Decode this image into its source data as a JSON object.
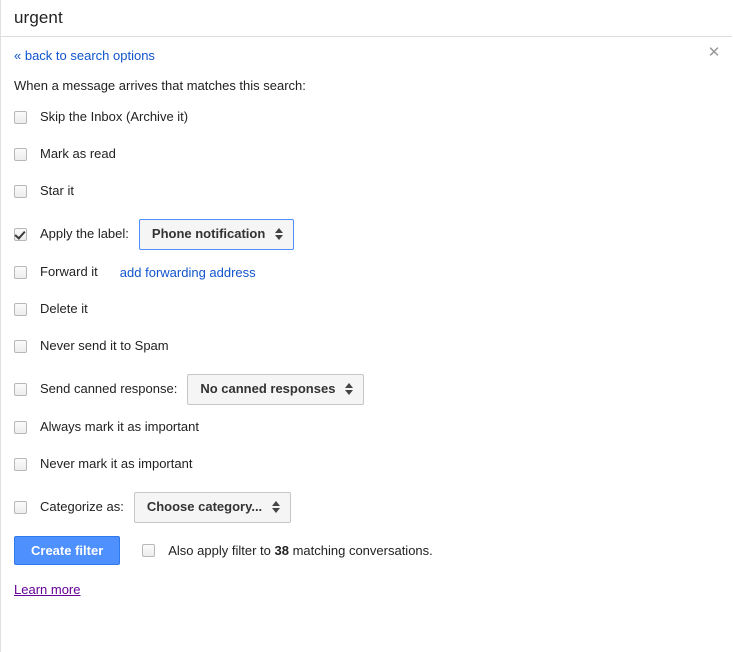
{
  "search": {
    "query": "urgent"
  },
  "panel": {
    "close_icon": "close-icon",
    "back_link": "« back to search options",
    "intro": "When a message arrives that matches this search:"
  },
  "options": [
    {
      "label": "Skip the Inbox (Archive it)",
      "checked": false,
      "name": "skip-inbox"
    },
    {
      "label": "Mark as read",
      "checked": false,
      "name": "mark-as-read"
    },
    {
      "label": "Star it",
      "checked": false,
      "name": "star-it"
    },
    {
      "label": "Apply the label:",
      "checked": true,
      "name": "apply-label"
    },
    {
      "label": "Forward it",
      "checked": false,
      "name": "forward-it"
    },
    {
      "label": "Delete it",
      "checked": false,
      "name": "delete-it"
    },
    {
      "label": "Never send it to Spam",
      "checked": false,
      "name": "never-spam"
    },
    {
      "label": "Send canned response:",
      "checked": false,
      "name": "send-canned-response"
    },
    {
      "label": "Always mark it as important",
      "checked": false,
      "name": "always-important"
    },
    {
      "label": "Never mark it as important",
      "checked": false,
      "name": "never-important"
    },
    {
      "label": "Categorize as:",
      "checked": false,
      "name": "categorize-as"
    }
  ],
  "selects": {
    "label": {
      "value": "Phone notification"
    },
    "canned": {
      "value": "No canned responses"
    },
    "category": {
      "value": "Choose category..."
    }
  },
  "links": {
    "add_forwarding_address": "add forwarding address",
    "learn_more": "Learn more"
  },
  "footer": {
    "create_button": "Create filter",
    "also_apply_prefix": "Also apply filter to",
    "matching_count": "38",
    "also_apply_suffix": "matching conversations.",
    "also_apply_checked": false
  },
  "colors": {
    "link_blue": "#1155cc",
    "button_blue": "#4d90fe",
    "visited_purple": "#660099",
    "select_border_active": "#4d90fe"
  }
}
